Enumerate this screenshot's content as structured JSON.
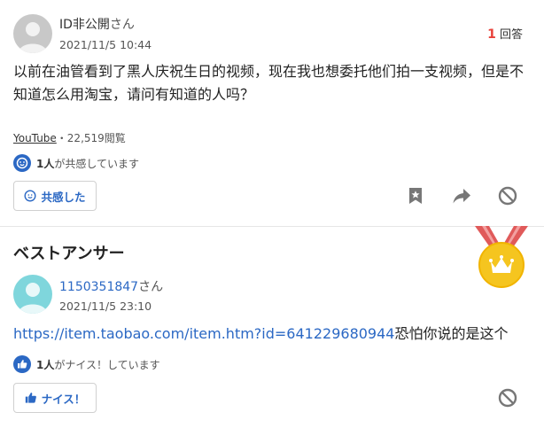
{
  "question": {
    "username": "ID非公開",
    "username_suffix": "さん",
    "date": "2021/11/5 10:44",
    "answer_count": "1",
    "answer_count_label": "回答",
    "body": "以前在油管看到了黑人庆祝生日的视频，现在我也想委托他们拍一支视频，但是不知道怎么用淘宝，请问有知道的人吗？",
    "category": "YouTube",
    "views": "・22,519閲覧",
    "empathy_count": "1人",
    "empathy_text": "が共感しています",
    "empathy_button_label": "共感した"
  },
  "best_answer": {
    "heading": "ベストアンサー",
    "username": "1150351847",
    "username_suffix": "さん",
    "date": "2021/11/5 23:10",
    "link": "https://item.taobao.com/item.htm?id=641229680944",
    "text_after_link": "恐怕你说的是这个",
    "nice_count": "1人",
    "nice_text": "がナイス！しています",
    "nice_button_label": "ナイス！"
  },
  "colors": {
    "link": "#2b68c4",
    "answer_count": "#e8413a",
    "medal_ribbon": "#e05a5a",
    "medal": "#f5c51f",
    "icon_gray": "#777777"
  }
}
